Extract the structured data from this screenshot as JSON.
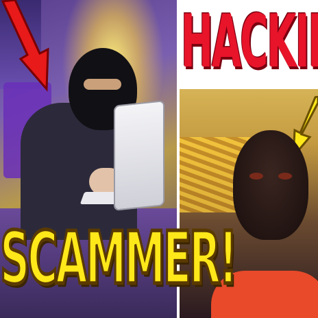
{
  "thumbnail": {
    "left_caption": "SCAMMER!",
    "right_caption": "HACKING",
    "colors": {
      "left_caption": "#ffe81a",
      "right_caption": "#e8142a",
      "arrow_left": "#e81a1a",
      "arrow_right": "#ffe81a",
      "divider": "#ffffff"
    },
    "icons": {
      "arrow_left": "red-arrow-icon",
      "arrow_right": "yellow-arrow-icon"
    }
  }
}
